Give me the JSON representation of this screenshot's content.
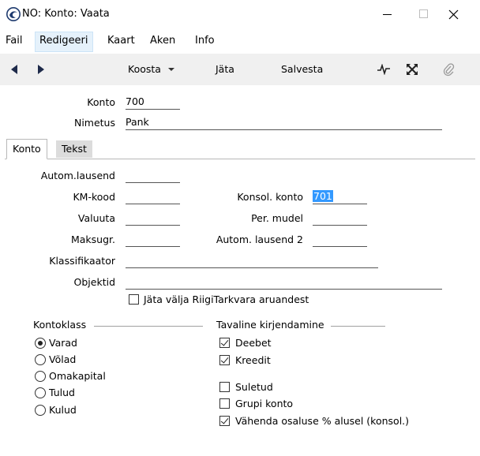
{
  "window": {
    "title": "NO: Konto: Vaata"
  },
  "menu": [
    "Fail",
    "Redigeeri",
    "Kaart",
    "Aken",
    "Info"
  ],
  "toolbar": {
    "koosta": "Koosta",
    "jata": "Jäta",
    "salvesta": "Salvesta"
  },
  "header": {
    "konto_label": "Konto",
    "konto_value": "700",
    "nimetus_label": "Nimetus",
    "nimetus_value": "Pank"
  },
  "tabs": [
    "Konto",
    "Tekst"
  ],
  "fields": {
    "autom_lausend": {
      "label": "Autom.lausend",
      "value": ""
    },
    "km_kood": {
      "label": "KM-kood",
      "value": ""
    },
    "valuuta": {
      "label": "Valuuta",
      "value": ""
    },
    "maksugr": {
      "label": "Maksugr.",
      "value": ""
    },
    "klassifikaator": {
      "label": "Klassifikaator",
      "value": ""
    },
    "objektid": {
      "label": "Objektid",
      "value": ""
    },
    "konsol_konto": {
      "label": "Konsol. konto",
      "value": "701"
    },
    "per_mudel": {
      "label": "Per. mudel",
      "value": ""
    },
    "autom_lausend2": {
      "label": "Autom. lausend 2",
      "value": ""
    }
  },
  "exclude_checkbox": {
    "label": "Jäta välja RiigiTarkvara aruandest",
    "checked": false
  },
  "kontoklass": {
    "title": "Kontoklass",
    "options": [
      "Varad",
      "Võlad",
      "Omakapital",
      "Tulud",
      "Kulud"
    ],
    "selected": "Varad"
  },
  "posting": {
    "title": "Tavaline kirjendamine",
    "deebet": {
      "label": "Deebet",
      "checked": true
    },
    "kreedit": {
      "label": "Kreedit",
      "checked": true
    },
    "suletud": {
      "label": "Suletud",
      "checked": false
    },
    "grupi": {
      "label": "Grupi konto",
      "checked": false
    },
    "vahenda": {
      "label": "Vähenda osaluse % alusel (konsol.)",
      "checked": true
    }
  }
}
